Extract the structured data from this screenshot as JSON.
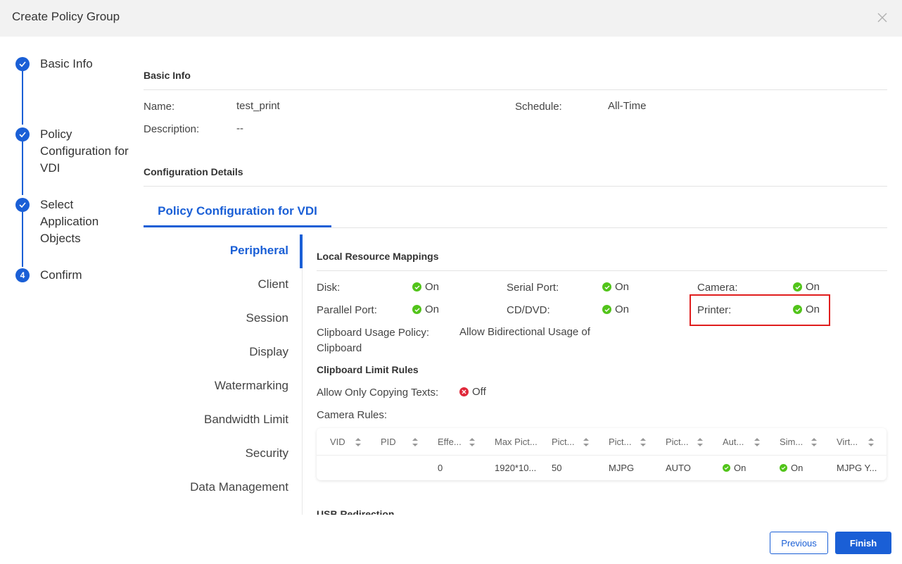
{
  "dialog": {
    "title": "Create Policy Group"
  },
  "stepper": [
    {
      "label": "Basic Info",
      "state": "done"
    },
    {
      "label": "Policy Configuration for VDI",
      "state": "done"
    },
    {
      "label": "Select Application Objects",
      "state": "done"
    },
    {
      "label": "Confirm",
      "state": "current",
      "number": "4"
    }
  ],
  "basic_info": {
    "title": "Basic Info",
    "name_label": "Name:",
    "name_value": "test_print",
    "schedule_label": "Schedule:",
    "schedule_value": "All-Time",
    "description_label": "Description:",
    "description_value": "--"
  },
  "config": {
    "title": "Configuration Details",
    "tab": "Policy Configuration for VDI",
    "sidenav": [
      "Peripheral",
      "Client",
      "Session",
      "Display",
      "Watermarking",
      "Bandwidth Limit",
      "Security",
      "Data Management"
    ]
  },
  "peripheral": {
    "title": "Local Resource Mappings",
    "disk_label": "Disk:",
    "disk_value": "On",
    "serial_label": "Serial Port:",
    "serial_value": "On",
    "camera_label": "Camera:",
    "camera_value": "On",
    "parallel_label": "Parallel Port:",
    "parallel_value": "On",
    "cddvd_label": "CD/DVD:",
    "cddvd_value": "On",
    "printer_label": "Printer:",
    "printer_value": "On",
    "clipboard_label": "Clipboard Usage Policy:",
    "clipboard_value_1": "Allow Bidirectional Usage of",
    "clipboard_value_2": "Clipboard",
    "clipboard_rules_title": "Clipboard Limit Rules",
    "copy_text_label": "Allow Only Copying Texts:",
    "copy_text_value": "Off",
    "camera_rules_label": "Camera Rules:",
    "next_section_partial": "USB Redirection"
  },
  "camera_table": {
    "headers": [
      "VID",
      "PID",
      "Effe...",
      "Max Pict...",
      "Pict...",
      "Pict...",
      "Pict...",
      "Aut...",
      "Sim...",
      "Virt..."
    ],
    "row": [
      "",
      "",
      "0",
      "1920*10...",
      "50",
      "MJPG",
      "AUTO",
      "On",
      "On",
      "MJPG Y..."
    ]
  },
  "footer": {
    "previous": "Previous",
    "finish": "Finish"
  },
  "colors": {
    "accent": "#1a5fd6",
    "on": "#52c41a",
    "off": "#e0283a",
    "highlight": "#e01e1e"
  }
}
